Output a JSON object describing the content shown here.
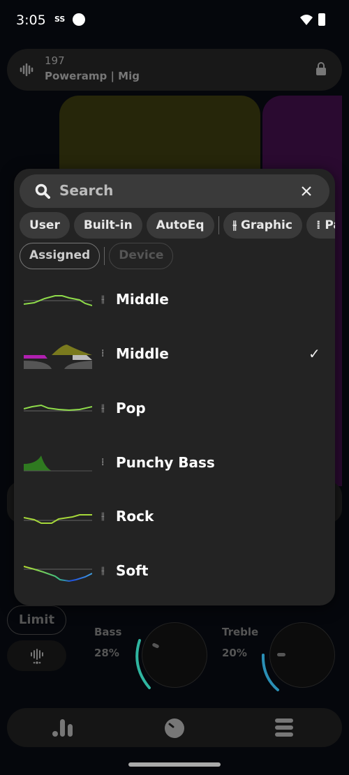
{
  "status_bar": {
    "time": "3:05",
    "icons": [
      "sxs-icon",
      "equalizer-app-icon",
      "wifi-icon",
      "battery-charging-icon"
    ]
  },
  "header": {
    "number": "197",
    "title": "Poweramp | Mig",
    "icons": [
      "waveform-icon",
      "lock-icon"
    ]
  },
  "popup": {
    "search": {
      "placeholder": "Search"
    },
    "chips": [
      {
        "label": "User"
      },
      {
        "label": "Built-in"
      },
      {
        "label": "AutoEq"
      },
      {
        "label": "Graphic",
        "icon": "graphic-eq-icon"
      },
      {
        "label": "Pa",
        "icon": "parametric-eq-icon"
      }
    ],
    "filters": [
      {
        "label": "Assigned",
        "enabled": true
      },
      {
        "label": "Device",
        "enabled": false
      }
    ],
    "presets": [
      {
        "name": "Middle",
        "type": "graphic",
        "selected": false
      },
      {
        "name": "Middle",
        "type": "parametric",
        "selected": true
      },
      {
        "name": "Pop",
        "type": "graphic",
        "selected": false
      },
      {
        "name": "Punchy Bass",
        "type": "parametric",
        "selected": false
      },
      {
        "name": "Rock",
        "type": "graphic",
        "selected": false
      },
      {
        "name": "Soft",
        "type": "graphic",
        "selected": false
      }
    ],
    "check_glyph": "✓"
  },
  "controls": {
    "limit_label": "Limit",
    "bass": {
      "label": "Bass",
      "value": "28%",
      "level": 0.28
    },
    "treble": {
      "label": "Treble",
      "value": "20%",
      "level": 0.2
    },
    "accent": "#2fb5a0"
  },
  "nav": {
    "items": [
      "equalizer-icon",
      "tone-knob-icon",
      "menu-icon"
    ]
  }
}
